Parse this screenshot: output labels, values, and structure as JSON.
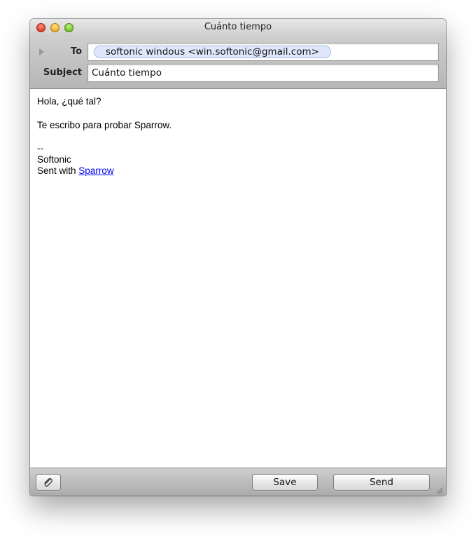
{
  "window": {
    "title": "Cuánto tiempo"
  },
  "header": {
    "to_label": "To",
    "to_recipient": "softonic windous <win.softonic@gmail.com>",
    "subject_label": "Subject",
    "subject_value": "Cuánto tiempo"
  },
  "message": {
    "greeting": "Hola, ¿qué tal?",
    "body": "Te escribo para probar Sparrow.",
    "sig_separator": "--",
    "sig_name": "Softonic",
    "sent_with": "Sent with",
    "sent_link": "Sparrow"
  },
  "toolbar": {
    "attach_icon": "paperclip-icon",
    "save_label": "Save",
    "send_label": "Send"
  },
  "colors": {
    "token_bg": "#dfe8fb",
    "link": "#0000ee"
  }
}
